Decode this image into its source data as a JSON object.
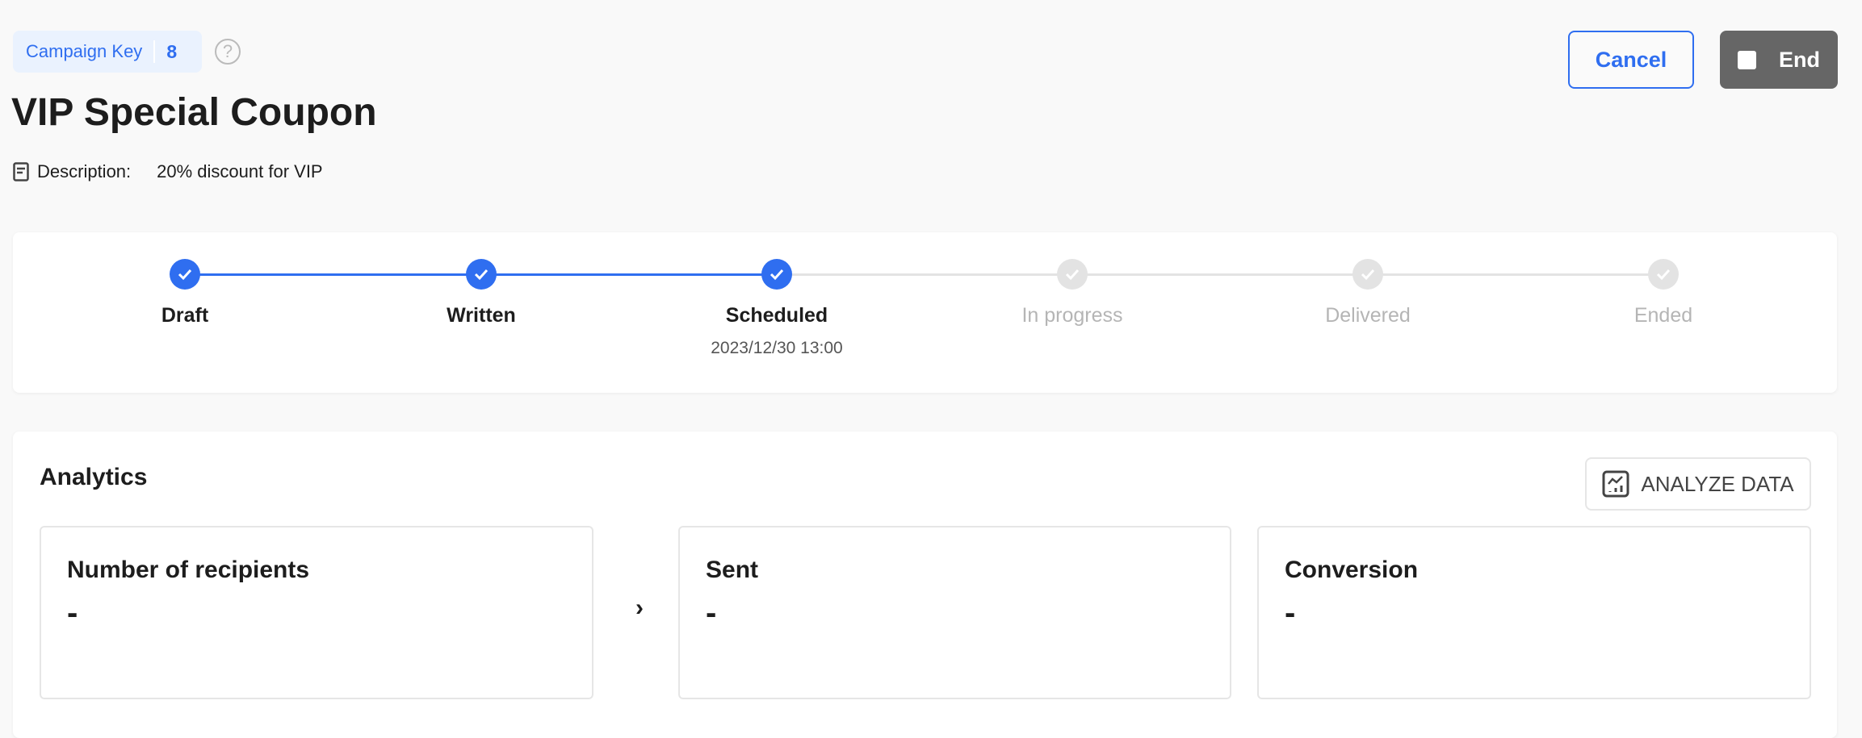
{
  "header": {
    "campaign_key_label": "Campaign Key",
    "campaign_key_value": "8",
    "help_icon": "?",
    "title": "VIP Special Coupon",
    "description_label": "Description:",
    "description_value": "20% discount for VIP",
    "cancel_label": "Cancel",
    "end_label": "End"
  },
  "colors": {
    "accent": "#2f6ef0",
    "inactive": "#e3e3e3",
    "end_button": "#666666"
  },
  "stepper": {
    "steps": [
      {
        "label": "Draft",
        "done": true
      },
      {
        "label": "Written",
        "done": true
      },
      {
        "label": "Scheduled",
        "done": true,
        "date": "2023/12/30 13:00"
      },
      {
        "label": "In progress",
        "done": false
      },
      {
        "label": "Delivered",
        "done": false
      },
      {
        "label": "Ended",
        "done": false
      }
    ]
  },
  "analytics": {
    "title": "Analytics",
    "analyze_label": "ANALYZE DATA",
    "metrics": [
      {
        "title": "Number of recipients",
        "value": "-"
      },
      {
        "title": "Sent",
        "value": "-"
      },
      {
        "title": "Conversion",
        "value": "-"
      }
    ]
  }
}
